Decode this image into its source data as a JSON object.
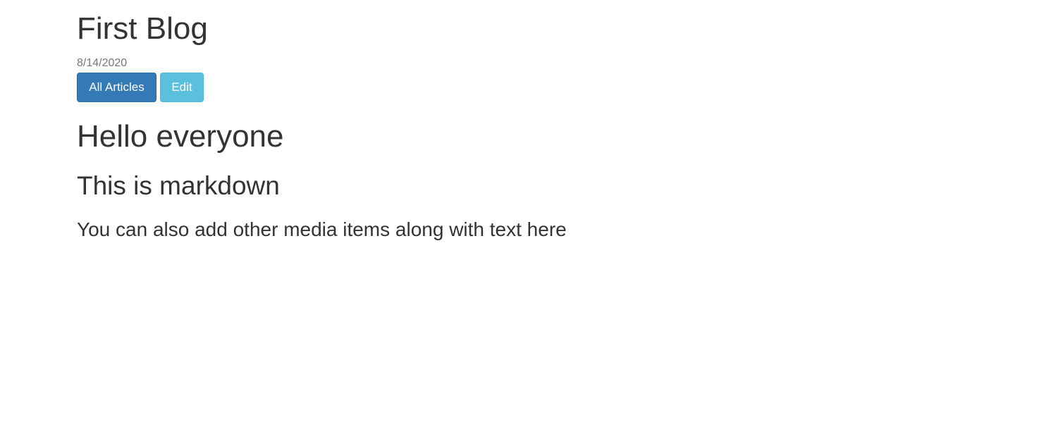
{
  "article": {
    "title": "First Blog",
    "date": "8/14/2020"
  },
  "actions": {
    "all_articles_label": "All Articles",
    "edit_label": "Edit"
  },
  "content": {
    "heading": "Hello everyone",
    "subheading": "This is markdown",
    "paragraph": "You can also add other media items along with text here"
  },
  "colors": {
    "primary": "#337ab7",
    "info": "#5bc0de",
    "text": "#333333",
    "muted": "#777777"
  }
}
